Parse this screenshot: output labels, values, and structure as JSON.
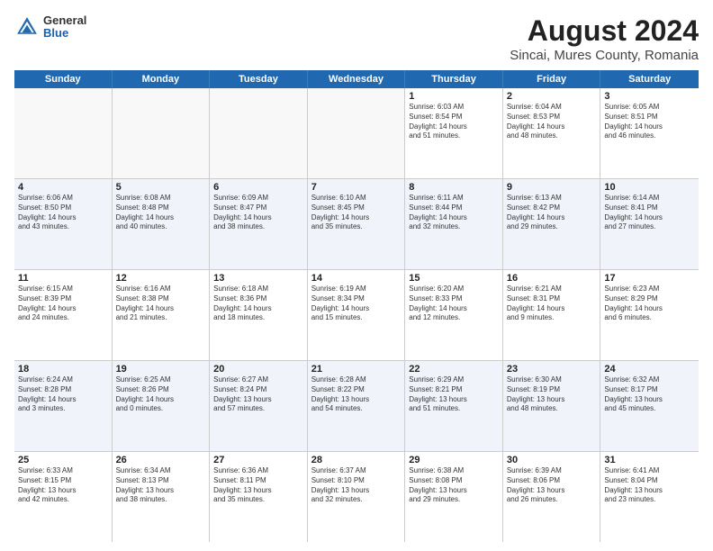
{
  "header": {
    "title": "August 2024",
    "subtitle": "Sincai, Mures County, Romania",
    "logo_general": "General",
    "logo_blue": "Blue"
  },
  "days_of_week": [
    "Sunday",
    "Monday",
    "Tuesday",
    "Wednesday",
    "Thursday",
    "Friday",
    "Saturday"
  ],
  "weeks": [
    [
      {
        "day": "",
        "info": ""
      },
      {
        "day": "",
        "info": ""
      },
      {
        "day": "",
        "info": ""
      },
      {
        "day": "",
        "info": ""
      },
      {
        "day": "1",
        "info": "Sunrise: 6:03 AM\nSunset: 8:54 PM\nDaylight: 14 hours\nand 51 minutes."
      },
      {
        "day": "2",
        "info": "Sunrise: 6:04 AM\nSunset: 8:53 PM\nDaylight: 14 hours\nand 48 minutes."
      },
      {
        "day": "3",
        "info": "Sunrise: 6:05 AM\nSunset: 8:51 PM\nDaylight: 14 hours\nand 46 minutes."
      }
    ],
    [
      {
        "day": "4",
        "info": "Sunrise: 6:06 AM\nSunset: 8:50 PM\nDaylight: 14 hours\nand 43 minutes."
      },
      {
        "day": "5",
        "info": "Sunrise: 6:08 AM\nSunset: 8:48 PM\nDaylight: 14 hours\nand 40 minutes."
      },
      {
        "day": "6",
        "info": "Sunrise: 6:09 AM\nSunset: 8:47 PM\nDaylight: 14 hours\nand 38 minutes."
      },
      {
        "day": "7",
        "info": "Sunrise: 6:10 AM\nSunset: 8:45 PM\nDaylight: 14 hours\nand 35 minutes."
      },
      {
        "day": "8",
        "info": "Sunrise: 6:11 AM\nSunset: 8:44 PM\nDaylight: 14 hours\nand 32 minutes."
      },
      {
        "day": "9",
        "info": "Sunrise: 6:13 AM\nSunset: 8:42 PM\nDaylight: 14 hours\nand 29 minutes."
      },
      {
        "day": "10",
        "info": "Sunrise: 6:14 AM\nSunset: 8:41 PM\nDaylight: 14 hours\nand 27 minutes."
      }
    ],
    [
      {
        "day": "11",
        "info": "Sunrise: 6:15 AM\nSunset: 8:39 PM\nDaylight: 14 hours\nand 24 minutes."
      },
      {
        "day": "12",
        "info": "Sunrise: 6:16 AM\nSunset: 8:38 PM\nDaylight: 14 hours\nand 21 minutes."
      },
      {
        "day": "13",
        "info": "Sunrise: 6:18 AM\nSunset: 8:36 PM\nDaylight: 14 hours\nand 18 minutes."
      },
      {
        "day": "14",
        "info": "Sunrise: 6:19 AM\nSunset: 8:34 PM\nDaylight: 14 hours\nand 15 minutes."
      },
      {
        "day": "15",
        "info": "Sunrise: 6:20 AM\nSunset: 8:33 PM\nDaylight: 14 hours\nand 12 minutes."
      },
      {
        "day": "16",
        "info": "Sunrise: 6:21 AM\nSunset: 8:31 PM\nDaylight: 14 hours\nand 9 minutes."
      },
      {
        "day": "17",
        "info": "Sunrise: 6:23 AM\nSunset: 8:29 PM\nDaylight: 14 hours\nand 6 minutes."
      }
    ],
    [
      {
        "day": "18",
        "info": "Sunrise: 6:24 AM\nSunset: 8:28 PM\nDaylight: 14 hours\nand 3 minutes."
      },
      {
        "day": "19",
        "info": "Sunrise: 6:25 AM\nSunset: 8:26 PM\nDaylight: 14 hours\nand 0 minutes."
      },
      {
        "day": "20",
        "info": "Sunrise: 6:27 AM\nSunset: 8:24 PM\nDaylight: 13 hours\nand 57 minutes."
      },
      {
        "day": "21",
        "info": "Sunrise: 6:28 AM\nSunset: 8:22 PM\nDaylight: 13 hours\nand 54 minutes."
      },
      {
        "day": "22",
        "info": "Sunrise: 6:29 AM\nSunset: 8:21 PM\nDaylight: 13 hours\nand 51 minutes."
      },
      {
        "day": "23",
        "info": "Sunrise: 6:30 AM\nSunset: 8:19 PM\nDaylight: 13 hours\nand 48 minutes."
      },
      {
        "day": "24",
        "info": "Sunrise: 6:32 AM\nSunset: 8:17 PM\nDaylight: 13 hours\nand 45 minutes."
      }
    ],
    [
      {
        "day": "25",
        "info": "Sunrise: 6:33 AM\nSunset: 8:15 PM\nDaylight: 13 hours\nand 42 minutes."
      },
      {
        "day": "26",
        "info": "Sunrise: 6:34 AM\nSunset: 8:13 PM\nDaylight: 13 hours\nand 38 minutes."
      },
      {
        "day": "27",
        "info": "Sunrise: 6:36 AM\nSunset: 8:11 PM\nDaylight: 13 hours\nand 35 minutes."
      },
      {
        "day": "28",
        "info": "Sunrise: 6:37 AM\nSunset: 8:10 PM\nDaylight: 13 hours\nand 32 minutes."
      },
      {
        "day": "29",
        "info": "Sunrise: 6:38 AM\nSunset: 8:08 PM\nDaylight: 13 hours\nand 29 minutes."
      },
      {
        "day": "30",
        "info": "Sunrise: 6:39 AM\nSunset: 8:06 PM\nDaylight: 13 hours\nand 26 minutes."
      },
      {
        "day": "31",
        "info": "Sunrise: 6:41 AM\nSunset: 8:04 PM\nDaylight: 13 hours\nand 23 minutes."
      }
    ]
  ]
}
